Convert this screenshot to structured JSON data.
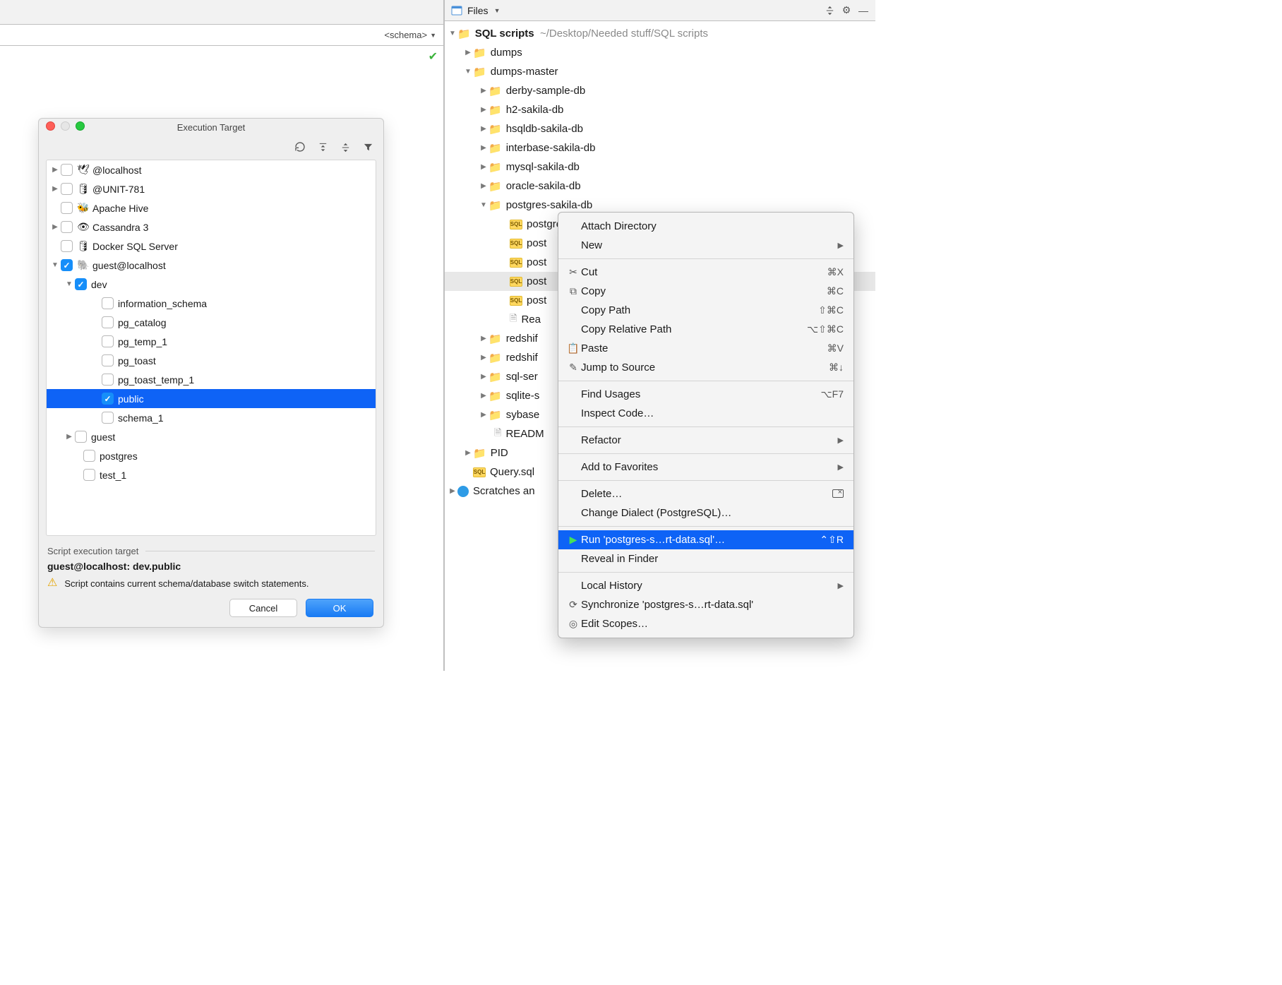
{
  "editor": {
    "schema_dd": "<schema>"
  },
  "dialog": {
    "title": "Execution Target",
    "datasources": [
      {
        "name": "@localhost",
        "icon": "🕊",
        "expandable": true,
        "expanded": false,
        "checked": false
      },
      {
        "name": "@UNIT-781",
        "icon": "🛢",
        "expandable": true,
        "expanded": false,
        "checked": false
      },
      {
        "name": "Apache Hive",
        "icon": "🐝",
        "expandable": false,
        "expanded": false,
        "checked": false
      },
      {
        "name": "Cassandra 3",
        "icon": "👁",
        "expandable": true,
        "expanded": false,
        "checked": false
      },
      {
        "name": "Docker SQL Server",
        "icon": "🛢",
        "expandable": false,
        "expanded": false,
        "checked": false
      },
      {
        "name": "guest@localhost",
        "icon": "🐘",
        "expandable": true,
        "expanded": true,
        "checked": true
      }
    ],
    "pg_dbs": {
      "dev": {
        "checked": true,
        "expanded": true
      },
      "guest": {
        "checked": false,
        "expanded": false,
        "expandable": true
      },
      "postgres": {
        "checked": false
      },
      "test_1": {
        "checked": false
      }
    },
    "dev_schemas": {
      "information_schema": {
        "checked": false
      },
      "pg_catalog": {
        "checked": false
      },
      "pg_temp_1": {
        "checked": false
      },
      "pg_toast": {
        "checked": false
      },
      "pg_toast_temp_1": {
        "checked": false
      },
      "public": {
        "checked": true,
        "selected": true
      },
      "schema_1": {
        "checked": false
      }
    },
    "section_label": "Script execution target",
    "target_path": "guest@localhost: dev.public",
    "warning": "Script contains current schema/database switch statements.",
    "cancel": "Cancel",
    "ok": "OK"
  },
  "panel": {
    "title": "Files",
    "root": {
      "name": "SQL scripts",
      "path": "~/Desktop/Needed stuff/SQL scripts"
    },
    "dumps": "dumps",
    "dumps_master": "dumps-master",
    "dm_children": [
      "derby-sample-db",
      "h2-sakila-db",
      "hsqldb-sakila-db",
      "interbase-sakila-db",
      "mysql-sakila-db",
      "oracle-sakila-db"
    ],
    "pg_folder": "postgres-sakila-db",
    "pg_files": [
      "postgres-sakila-data.sql",
      "post",
      "post",
      "post",
      "post",
      "Rea"
    ],
    "pg_file_highlight_index": 3,
    "dm_tail": [
      "redshif",
      "redshif",
      "sql-ser",
      "sqlite-s",
      "sybase"
    ],
    "readme": "READM",
    "pid": "PID",
    "query": "Query.sql",
    "scratches": "Scratches an"
  },
  "ctx": {
    "attach": "Attach Directory",
    "new": "New",
    "cut": {
      "l": "Cut",
      "s": "⌘X"
    },
    "copy": {
      "l": "Copy",
      "s": "⌘C"
    },
    "copy_path": {
      "l": "Copy Path",
      "s": "⇧⌘C"
    },
    "copy_rel": {
      "l": "Copy Relative Path",
      "s": "⌥⇧⌘C"
    },
    "paste": {
      "l": "Paste",
      "s": "⌘V"
    },
    "jump": {
      "l": "Jump to Source",
      "s": "⌘↓"
    },
    "find": {
      "l": "Find Usages",
      "s": "⌥F7"
    },
    "inspect": "Inspect Code…",
    "refactor": "Refactor",
    "fav": "Add to Favorites",
    "delete": "Delete…",
    "dialect": "Change Dialect (PostgreSQL)…",
    "run": {
      "l": "Run 'postgres-s…rt-data.sql'…",
      "s": "⌃⇧R"
    },
    "reveal": "Reveal in Finder",
    "history": "Local History",
    "sync": "Synchronize 'postgres-s…rt-data.sql'",
    "scopes": "Edit Scopes…"
  }
}
